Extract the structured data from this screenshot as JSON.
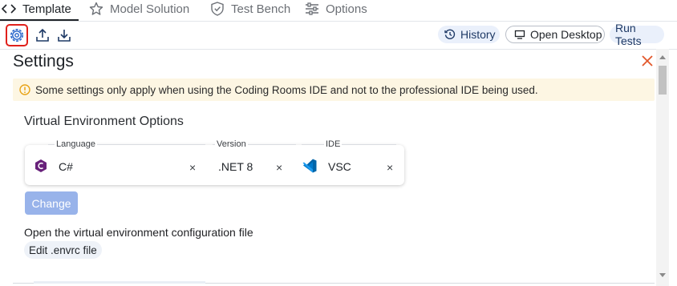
{
  "tabs": [
    {
      "label": "Template",
      "icon": "code-icon",
      "active": true
    },
    {
      "label": "Model Solution",
      "icon": "star-icon",
      "active": false
    },
    {
      "label": "Test Bench",
      "icon": "shield-check-icon",
      "active": false
    },
    {
      "label": "Options",
      "icon": "sliders-icon",
      "active": false
    }
  ],
  "toolbar": {
    "icons": [
      "settings-gear-icon",
      "upload-icon",
      "download-icon"
    ],
    "history_label": "History",
    "open_desktop_label": "Open Desktop",
    "run_tests_label": "Run Tests"
  },
  "settings": {
    "title": "Settings",
    "banner_text": "Some settings only apply when using the Coding Rooms IDE and not to the professional IDE being used.",
    "section_title": "Virtual Environment Options",
    "language_label": "Language",
    "language_value": "C#",
    "version_label": "Version",
    "version_value": ".NET 8",
    "ide_label": "IDE",
    "ide_value": "VSC",
    "clear_symbol": "×",
    "change_label": "Change",
    "open_config_text": "Open the virtual environment configuration file",
    "edit_envrc_label": "Edit .envrc file"
  },
  "colors": {
    "accent": "#2563c9",
    "close": "#e2572b",
    "banner_bg": "#fdf6e3",
    "warning_icon": "#e8a317",
    "change_button": "#98b3ea",
    "csharp_logo": "#68217a",
    "vscode_logo": "#0065a9"
  }
}
